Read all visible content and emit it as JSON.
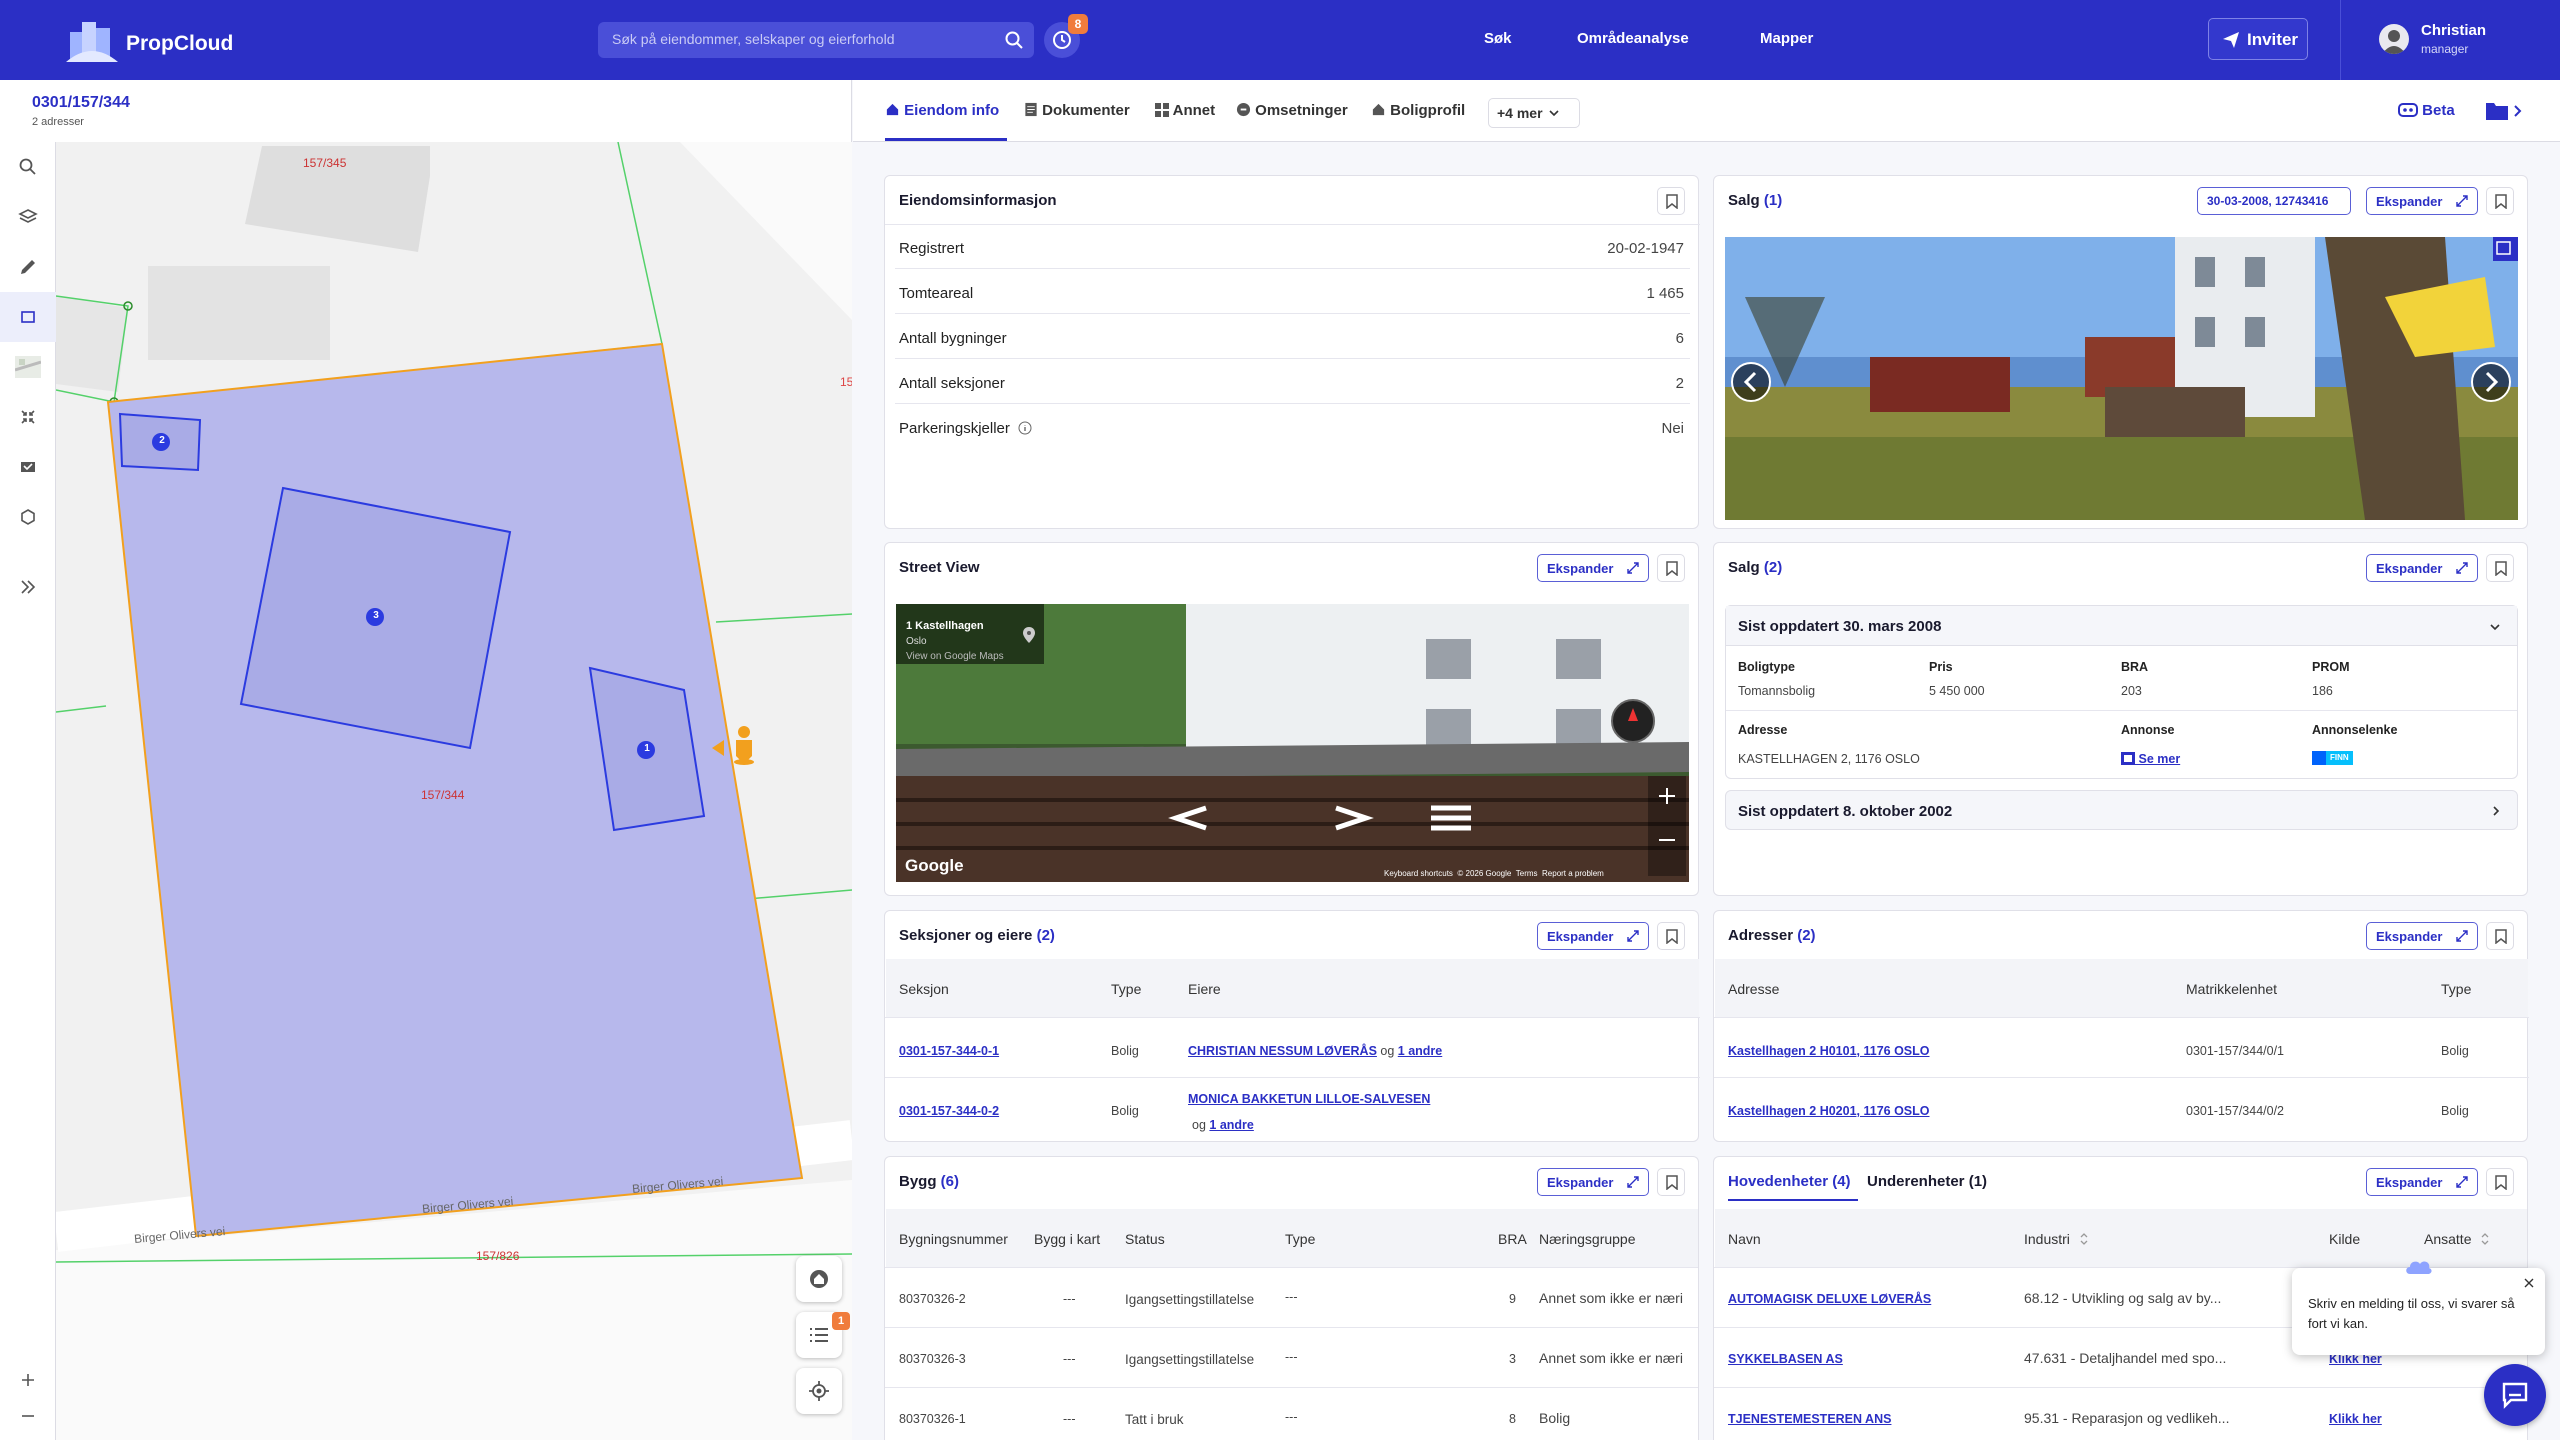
{
  "app": {
    "name": "PropCloud"
  },
  "header": {
    "search_placeholder": "Søk på eiendommer, selskaper og eierforhold",
    "history_badge": "8",
    "nav": [
      "Søk",
      "Områdeanalyse",
      "Mapper"
    ],
    "invite_label": "Inviter",
    "user_name": "Christian",
    "user_role": "manager"
  },
  "property": {
    "id": "0301/157/344",
    "addresses": "2 adresser"
  },
  "map": {
    "parcel_labels": [
      "157/345",
      "157/344",
      "157/826",
      "15"
    ],
    "road_labels": [
      "Birger Olivers vei",
      "Birger Olivers vei",
      "Birger Olivers vei"
    ],
    "building_markers": [
      "2",
      "3",
      "1"
    ],
    "list_badge": "1"
  },
  "tabs": {
    "items": [
      "Eiendom info",
      "Dokumenter",
      "Annet",
      "Omsetninger",
      "Boligprofil"
    ],
    "more": "+4 mer",
    "beta": "Beta"
  },
  "eiendom": {
    "title": "Eiendomsinformasjon",
    "rows": [
      {
        "label": "Registrert",
        "value": "20-02-1947"
      },
      {
        "label": "Tomteareal",
        "value": "1 465"
      },
      {
        "label": "Antall bygninger",
        "value": "6"
      },
      {
        "label": "Antall seksjoner",
        "value": "2"
      },
      {
        "label": "Parkeringskjeller",
        "value": "Nei"
      }
    ]
  },
  "salg1": {
    "title": "Salg",
    "count": "(1)",
    "chip": "30-03-2008, 12743416",
    "expand": "Ekspander"
  },
  "streetview": {
    "title": "Street View",
    "expand": "Ekspander",
    "place": "1 Kastellhagen",
    "city": "Oslo",
    "maps_link": "View on Google Maps",
    "google": "Google",
    "footer": [
      "Keyboard shortcuts",
      "© 2026 Google",
      "Terms",
      "Report a problem"
    ]
  },
  "salg2": {
    "title": "Salg",
    "count": "(2)",
    "expand": "Ekspander",
    "sale1": {
      "header": "Sist oppdatert 30. mars 2008",
      "labels": [
        "Boligtype",
        "Pris",
        "BRA",
        "PROM"
      ],
      "values": [
        "Tomannsbolig",
        "5 450 000",
        "203",
        "186"
      ],
      "labels2": [
        "Adresse",
        "Annonse",
        "Annonselenke"
      ],
      "address": "KASTELLHAGEN 2, 1176 OSLO",
      "annonse": "Se mer",
      "finn": "FINN"
    },
    "sale2": {
      "header": "Sist oppdatert 8. oktober 2002"
    }
  },
  "seksjoner": {
    "title": "Seksjoner og eiere",
    "count": "(2)",
    "expand": "Ekspander",
    "cols": [
      "Seksjon",
      "Type",
      "Eiere"
    ],
    "rows": [
      {
        "seksjon": "0301-157-344-0-1",
        "type": "Bolig",
        "eier": "CHRISTIAN NESSUM LØVERÅS",
        "og": "og",
        "andre": "1 andre"
      },
      {
        "seksjon": "0301-157-344-0-2",
        "type": "Bolig",
        "eier": "MONICA BAKKETUN LILLOE-SALVESEN",
        "og": "og",
        "andre": "1 andre"
      }
    ]
  },
  "adresser": {
    "title": "Adresser",
    "count": "(2)",
    "expand": "Ekspander",
    "cols": [
      "Adresse",
      "Matrikkelenhet",
      "Type"
    ],
    "rows": [
      {
        "adresse": "Kastellhagen 2 H0101, 1176 OSLO",
        "matrikkel": "0301-157/344/0/1",
        "type": "Bolig"
      },
      {
        "adresse": "Kastellhagen 2 H0201, 1176 OSLO",
        "matrikkel": "0301-157/344/0/2",
        "type": "Bolig"
      }
    ]
  },
  "bygg": {
    "title": "Bygg",
    "count": "(6)",
    "expand": "Ekspander",
    "cols": [
      "Bygningsnummer",
      "Bygg i kart",
      "Status",
      "Type",
      "BRA",
      "Næringsgruppe"
    ],
    "rows": [
      {
        "nr": "80370326-2",
        "kart": "---",
        "status": "Igangsettingstillatelse",
        "type": "---",
        "bra": "9",
        "gruppe": "Annet som ikke er næri"
      },
      {
        "nr": "80370326-3",
        "kart": "---",
        "status": "Igangsettingstillatelse",
        "type": "---",
        "bra": "3",
        "gruppe": "Annet som ikke er næri"
      },
      {
        "nr": "80370326-1",
        "kart": "---",
        "status": "Tatt i bruk",
        "type": "---",
        "bra": "8",
        "gruppe": "Bolig"
      }
    ]
  },
  "enheter": {
    "tab1": "Hovedenheter",
    "tab1_count": "(4)",
    "tab2": "Underenheter",
    "tab2_count": "(1)",
    "expand": "Ekspander",
    "cols": [
      "Navn",
      "Industri",
      "Kilde",
      "Ansatte"
    ],
    "rows": [
      {
        "navn": "AUTOMAGISK DELUXE LØVERÅS",
        "industri": "68.12 - Utvikling og salg av by...",
        "kilde": ""
      },
      {
        "navn": "SYKKELBASEN AS",
        "industri": "47.631 - Detaljhandel med spo...",
        "kilde": "Klikk her"
      },
      {
        "navn": "TJENESTEMESTEREN ANS",
        "industri": "95.31 - Reparasjon og vedlikeh...",
        "kilde": "Klikk her"
      }
    ]
  },
  "chat": {
    "message": "Skriv en melding til oss, vi svarer så fort vi kan."
  },
  "colors": {
    "brand": "#2b2fc5",
    "accent": "#f07c3c"
  }
}
